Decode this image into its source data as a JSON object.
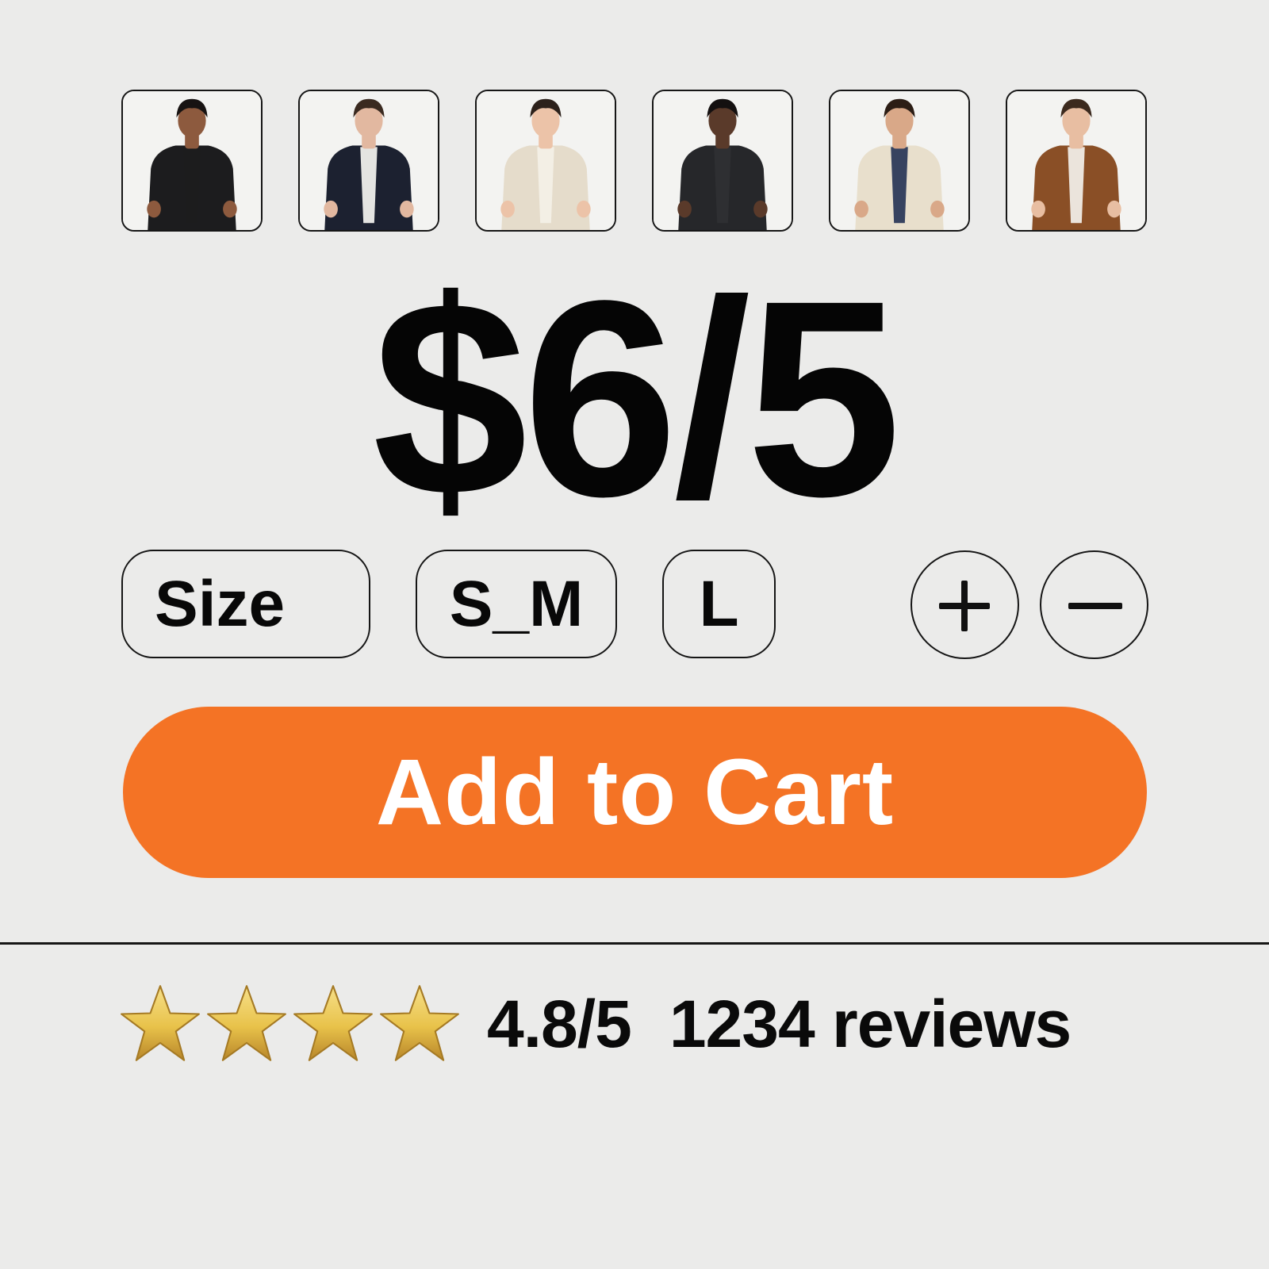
{
  "gallery": {
    "thumbnails": [
      {
        "icon": "model-black-hoodie-image",
        "garment_color": "#1c1c1e",
        "inner_color": "#1c1c1e",
        "hair_color": "#171312",
        "skin_color": "#8d5a3e",
        "pants_color": "#2a2a2e"
      },
      {
        "icon": "model-navy-jacket-image",
        "garment_color": "#1c2130",
        "inner_color": "#efefeb",
        "hair_color": "#3a2a20",
        "skin_color": "#e2b8a0",
        "pants_color": "#242a38"
      },
      {
        "icon": "model-cream-jacket-image",
        "garment_color": "#e5dccb",
        "inner_color": "#f3efe6",
        "hair_color": "#2c211b",
        "skin_color": "#ecc3a8",
        "pants_color": "#3c5b86"
      },
      {
        "icon": "model-charcoal-jacket-image",
        "garment_color": "#26272a",
        "inner_color": "#2e2f33",
        "hair_color": "#141010",
        "skin_color": "#5a3a2a",
        "pants_color": "#c7ae86"
      },
      {
        "icon": "model-cream-fleece-jacket-image",
        "garment_color": "#e8dfcc",
        "inner_color": "#2d3a5a",
        "hair_color": "#2c1d15",
        "skin_color": "#d9a888",
        "pants_color": "#4a6388"
      },
      {
        "icon": "model-brown-jacket-image",
        "garment_color": "#8a4f26",
        "inner_color": "#f0ece6",
        "hair_color": "#3c2a1e",
        "skin_color": "#e8bea2",
        "pants_color": "#3a3f4a"
      }
    ]
  },
  "price": "$6/5",
  "options": {
    "size_label": "Size",
    "sizes": [
      "S_M",
      "L"
    ]
  },
  "cart_button": {
    "label": "Add to Cart",
    "color": "#f47325"
  },
  "rating": {
    "stars": 4,
    "star_icon": "star-icon",
    "star_color": "#e8c24a",
    "score_text": "4.8/5",
    "count_text": "1234 reviews"
  }
}
